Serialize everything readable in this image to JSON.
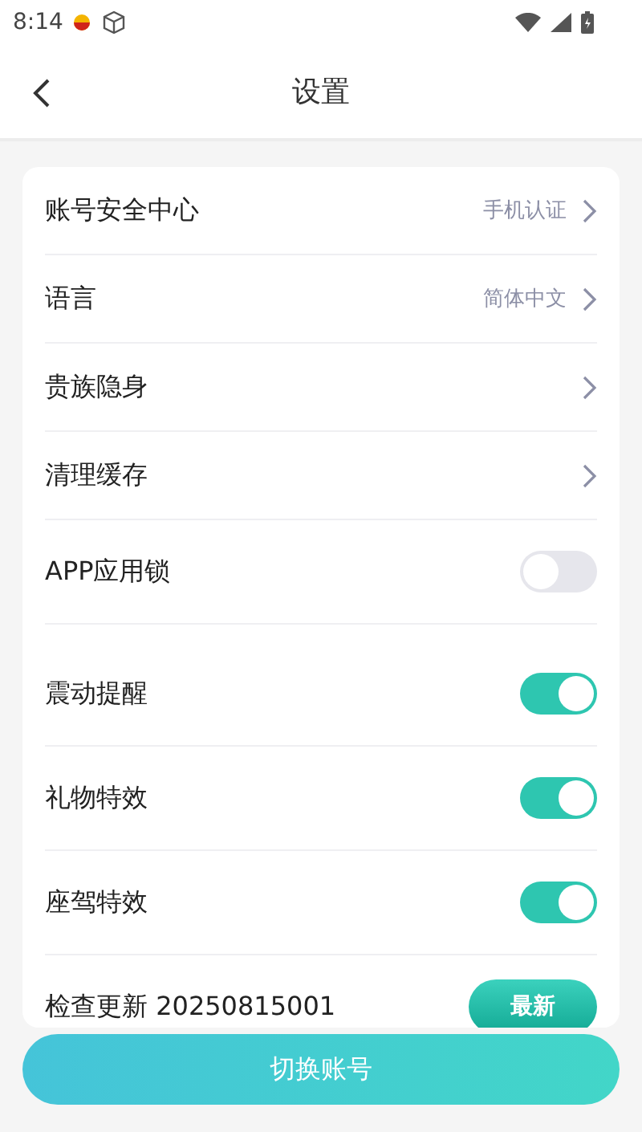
{
  "status_bar": {
    "time": "8:14"
  },
  "header": {
    "title": "设置"
  },
  "rows": [
    {
      "kind": "link",
      "label": "账号安全中心",
      "value": "手机认证"
    },
    {
      "kind": "link",
      "label": "语言",
      "value": "简体中文"
    },
    {
      "kind": "link",
      "label": "贵族隐身"
    },
    {
      "kind": "link",
      "label": "清理缓存"
    },
    {
      "kind": "toggle",
      "label": "APP应用锁",
      "on": false
    },
    {
      "kind": "toggle",
      "label": "震动提醒",
      "on": true
    },
    {
      "kind": "toggle",
      "label": "礼物特效",
      "on": true
    },
    {
      "kind": "toggle",
      "label": "座驾特效",
      "on": true
    },
    {
      "kind": "update",
      "label": "检查更新 20250815001",
      "button": "最新"
    }
  ],
  "switch_button": "切换账号"
}
